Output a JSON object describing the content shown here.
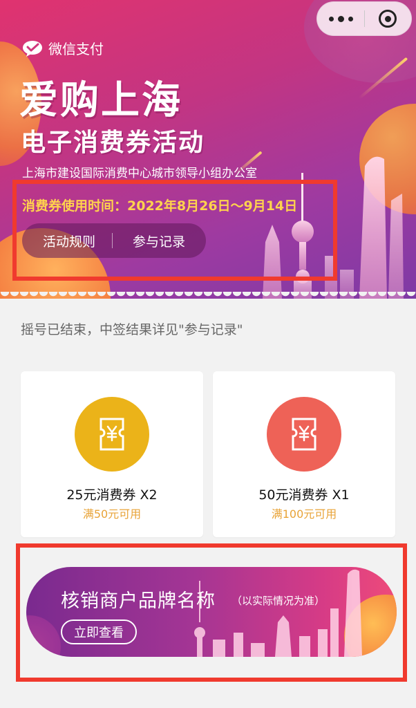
{
  "header": {
    "pay_brand": "微信支付",
    "title": "爱购上海",
    "subtitle": "电子消费券活动",
    "organizer": "上海市建设国际消费中心城市领导小组办公室",
    "usage_period": "消费券使用时间：2022年8月26日～9月14日",
    "rules_button": "活动规则",
    "records_button": "参与记录"
  },
  "capsule": {
    "more_icon": "more-dots-icon",
    "close_icon": "target-close-icon"
  },
  "notice": "摇号已结束，中签结果详见\"参与记录\"",
  "coupons": [
    {
      "name": "25元消费券 X2",
      "condition": "满50元可用",
      "color": "#ebb319",
      "icon": "ticket-yuan-icon"
    },
    {
      "name": "50元消费券 X1",
      "condition": "满100元可用",
      "color": "#ee6257",
      "icon": "ticket-yuan-icon"
    }
  ],
  "merchant": {
    "brand_name": "核销商户品牌名称",
    "note": "（以实际情况为准）",
    "view_button": "立即查看"
  },
  "colors": {
    "highlight": "#f03a2e",
    "period_text": "#ffd34d",
    "condition_text": "#e8a337"
  }
}
